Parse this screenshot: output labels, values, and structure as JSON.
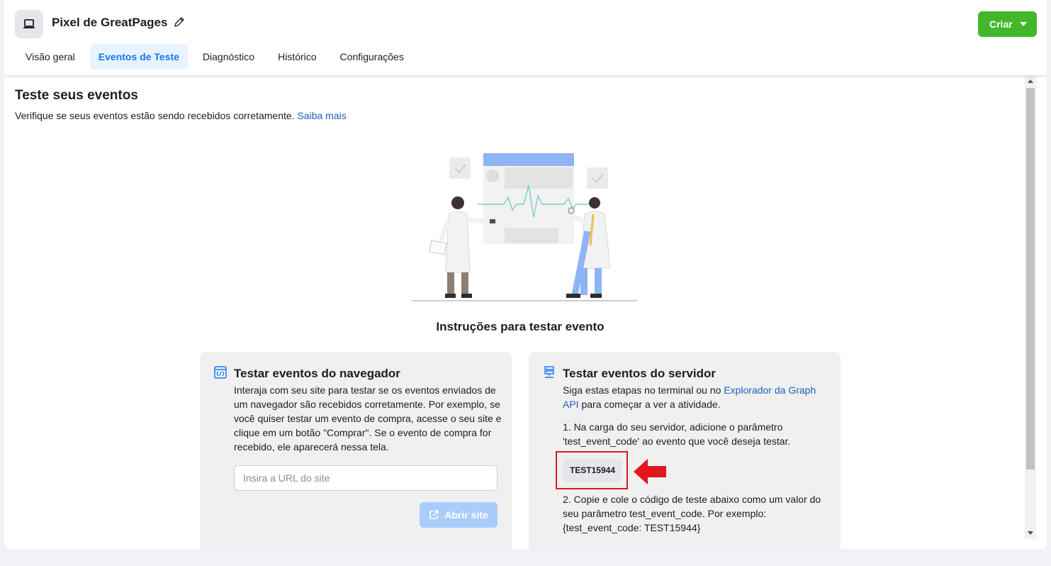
{
  "header": {
    "title": "Pixel de GreatPages",
    "create_label": "Criar"
  },
  "tabs": [
    {
      "label": "Visão geral",
      "active": false
    },
    {
      "label": "Eventos de Teste",
      "active": true
    },
    {
      "label": "Diagnóstico",
      "active": false
    },
    {
      "label": "Histórico",
      "active": false
    },
    {
      "label": "Configurações",
      "active": false
    }
  ],
  "section": {
    "title": "Teste seus eventos",
    "subtitle": "Verifique se seus eventos estão sendo recebidos corretamente.",
    "learn_more": "Saiba mais"
  },
  "instructions_title": "Instruções para testar evento",
  "browser_panel": {
    "title": "Testar eventos do navegador",
    "description": "Interaja com seu site para testar se os eventos enviados de um navegador são recebidos corretamente. Por exemplo, se você quiser testar um evento de compra, acesse o seu site e clique em um botão \"Comprar\". Se o evento de compra for recebido, ele aparecerá nessa tela.",
    "url_placeholder": "Insira a URL do site",
    "open_label": "Abrir site"
  },
  "server_panel": {
    "title": "Testar eventos do servidor",
    "intro_before": "Siga estas etapas no terminal ou no ",
    "intro_link": "Explorador da Graph API",
    "intro_after": " para começar a ver a atividade.",
    "step1": "1. Na carga do seu servidor, adicione o parâmetro 'test_event_code' ao evento que você deseja testar.",
    "test_code": "TEST15944",
    "step2": "2. Copie e cole o código de teste abaixo como um valor do seu parâmetro test_event_code. Por exemplo: {test_event_code: TEST15944}"
  },
  "colors": {
    "primary_green": "#42b72a",
    "accent_blue": "#1877f2",
    "link_blue": "#1d5fbf",
    "highlight_red": "#e0181e"
  }
}
